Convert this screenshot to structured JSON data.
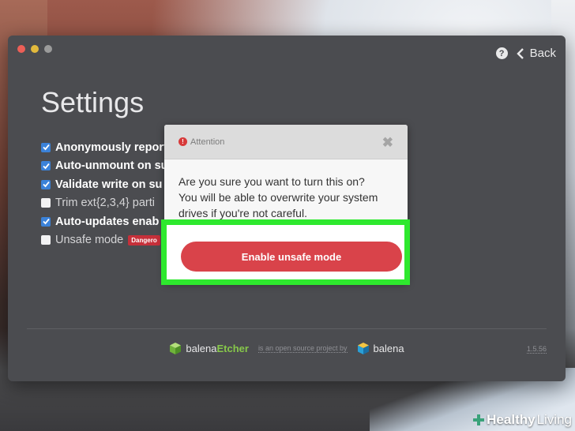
{
  "window": {
    "back_label": "Back",
    "help_glyph": "?",
    "title": "Settings"
  },
  "settings": {
    "options": [
      {
        "label": "Anonymously report",
        "checked": true
      },
      {
        "label": "Auto-unmount on su",
        "checked": true
      },
      {
        "label": "Validate write on su",
        "checked": true
      },
      {
        "label": "Trim ext{2,3,4} parti",
        "checked": false
      },
      {
        "label": "Auto-updates enab",
        "checked": true
      },
      {
        "label": "Unsafe mode",
        "checked": false,
        "badge": "Dangero"
      }
    ]
  },
  "modal": {
    "header_label": "Attention",
    "alert_glyph": "!",
    "close_glyph": "✖",
    "message": "Are you sure you want to turn this on? You will be able to overwrite your system drives if you're not careful.",
    "confirm_label": "Enable unsafe mode"
  },
  "footer": {
    "brand_a": "balena",
    "brand_b": "Etcher",
    "middle_text": "is an open source project by",
    "company": "balena",
    "version": "1.5.56"
  },
  "watermark": {
    "part_a": "Healthy",
    "part_b": "Living"
  },
  "colors": {
    "accent_red": "#d9434a",
    "checkbox_blue": "#3b82d9",
    "highlight_green": "#2ee82e",
    "etcher_green": "#87c84a"
  }
}
